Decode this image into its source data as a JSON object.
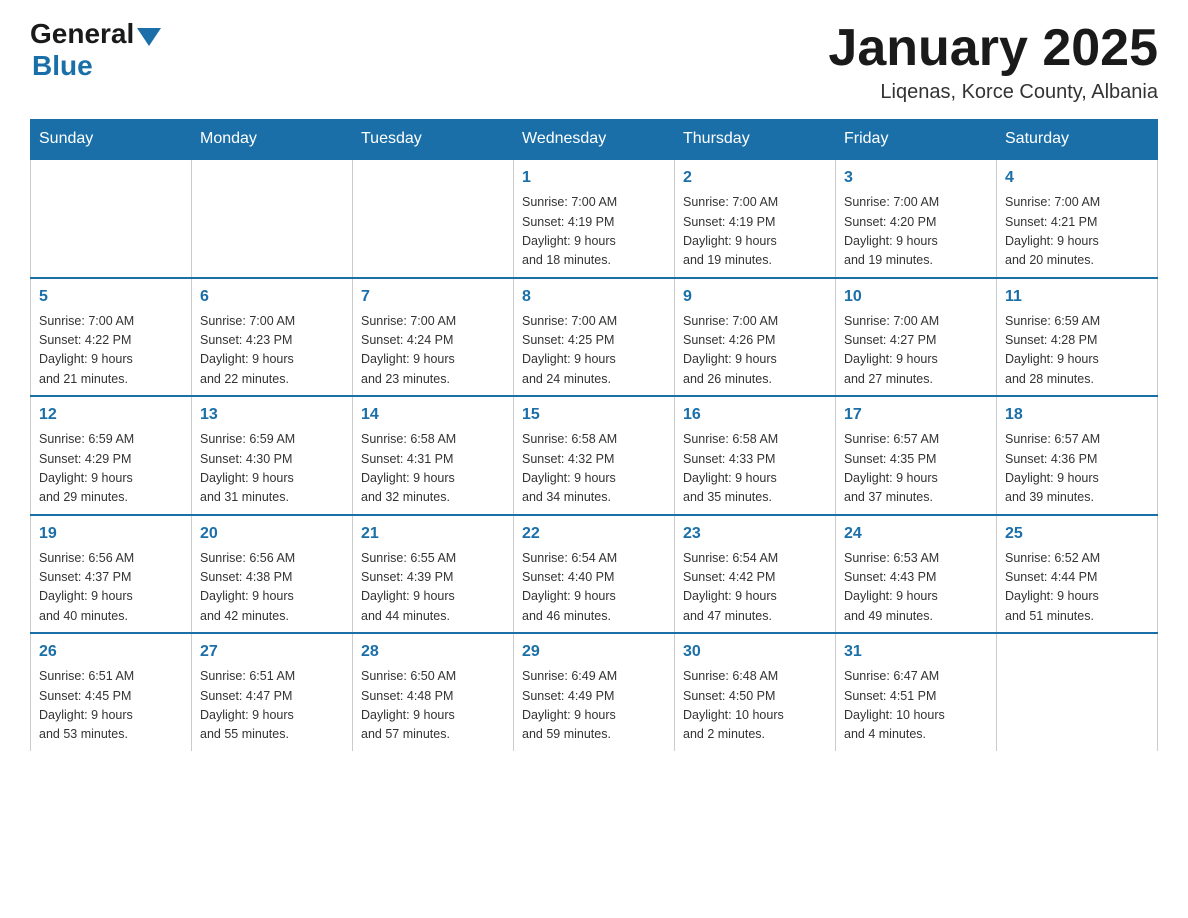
{
  "header": {
    "logo_general": "General",
    "logo_blue": "Blue",
    "title": "January 2025",
    "location": "Liqenas, Korce County, Albania"
  },
  "days_of_week": [
    "Sunday",
    "Monday",
    "Tuesday",
    "Wednesday",
    "Thursday",
    "Friday",
    "Saturday"
  ],
  "weeks": [
    [
      {
        "day": "",
        "info": ""
      },
      {
        "day": "",
        "info": ""
      },
      {
        "day": "",
        "info": ""
      },
      {
        "day": "1",
        "info": "Sunrise: 7:00 AM\nSunset: 4:19 PM\nDaylight: 9 hours\nand 18 minutes."
      },
      {
        "day": "2",
        "info": "Sunrise: 7:00 AM\nSunset: 4:19 PM\nDaylight: 9 hours\nand 19 minutes."
      },
      {
        "day": "3",
        "info": "Sunrise: 7:00 AM\nSunset: 4:20 PM\nDaylight: 9 hours\nand 19 minutes."
      },
      {
        "day": "4",
        "info": "Sunrise: 7:00 AM\nSunset: 4:21 PM\nDaylight: 9 hours\nand 20 minutes."
      }
    ],
    [
      {
        "day": "5",
        "info": "Sunrise: 7:00 AM\nSunset: 4:22 PM\nDaylight: 9 hours\nand 21 minutes."
      },
      {
        "day": "6",
        "info": "Sunrise: 7:00 AM\nSunset: 4:23 PM\nDaylight: 9 hours\nand 22 minutes."
      },
      {
        "day": "7",
        "info": "Sunrise: 7:00 AM\nSunset: 4:24 PM\nDaylight: 9 hours\nand 23 minutes."
      },
      {
        "day": "8",
        "info": "Sunrise: 7:00 AM\nSunset: 4:25 PM\nDaylight: 9 hours\nand 24 minutes."
      },
      {
        "day": "9",
        "info": "Sunrise: 7:00 AM\nSunset: 4:26 PM\nDaylight: 9 hours\nand 26 minutes."
      },
      {
        "day": "10",
        "info": "Sunrise: 7:00 AM\nSunset: 4:27 PM\nDaylight: 9 hours\nand 27 minutes."
      },
      {
        "day": "11",
        "info": "Sunrise: 6:59 AM\nSunset: 4:28 PM\nDaylight: 9 hours\nand 28 minutes."
      }
    ],
    [
      {
        "day": "12",
        "info": "Sunrise: 6:59 AM\nSunset: 4:29 PM\nDaylight: 9 hours\nand 29 minutes."
      },
      {
        "day": "13",
        "info": "Sunrise: 6:59 AM\nSunset: 4:30 PM\nDaylight: 9 hours\nand 31 minutes."
      },
      {
        "day": "14",
        "info": "Sunrise: 6:58 AM\nSunset: 4:31 PM\nDaylight: 9 hours\nand 32 minutes."
      },
      {
        "day": "15",
        "info": "Sunrise: 6:58 AM\nSunset: 4:32 PM\nDaylight: 9 hours\nand 34 minutes."
      },
      {
        "day": "16",
        "info": "Sunrise: 6:58 AM\nSunset: 4:33 PM\nDaylight: 9 hours\nand 35 minutes."
      },
      {
        "day": "17",
        "info": "Sunrise: 6:57 AM\nSunset: 4:35 PM\nDaylight: 9 hours\nand 37 minutes."
      },
      {
        "day": "18",
        "info": "Sunrise: 6:57 AM\nSunset: 4:36 PM\nDaylight: 9 hours\nand 39 minutes."
      }
    ],
    [
      {
        "day": "19",
        "info": "Sunrise: 6:56 AM\nSunset: 4:37 PM\nDaylight: 9 hours\nand 40 minutes."
      },
      {
        "day": "20",
        "info": "Sunrise: 6:56 AM\nSunset: 4:38 PM\nDaylight: 9 hours\nand 42 minutes."
      },
      {
        "day": "21",
        "info": "Sunrise: 6:55 AM\nSunset: 4:39 PM\nDaylight: 9 hours\nand 44 minutes."
      },
      {
        "day": "22",
        "info": "Sunrise: 6:54 AM\nSunset: 4:40 PM\nDaylight: 9 hours\nand 46 minutes."
      },
      {
        "day": "23",
        "info": "Sunrise: 6:54 AM\nSunset: 4:42 PM\nDaylight: 9 hours\nand 47 minutes."
      },
      {
        "day": "24",
        "info": "Sunrise: 6:53 AM\nSunset: 4:43 PM\nDaylight: 9 hours\nand 49 minutes."
      },
      {
        "day": "25",
        "info": "Sunrise: 6:52 AM\nSunset: 4:44 PM\nDaylight: 9 hours\nand 51 minutes."
      }
    ],
    [
      {
        "day": "26",
        "info": "Sunrise: 6:51 AM\nSunset: 4:45 PM\nDaylight: 9 hours\nand 53 minutes."
      },
      {
        "day": "27",
        "info": "Sunrise: 6:51 AM\nSunset: 4:47 PM\nDaylight: 9 hours\nand 55 minutes."
      },
      {
        "day": "28",
        "info": "Sunrise: 6:50 AM\nSunset: 4:48 PM\nDaylight: 9 hours\nand 57 minutes."
      },
      {
        "day": "29",
        "info": "Sunrise: 6:49 AM\nSunset: 4:49 PM\nDaylight: 9 hours\nand 59 minutes."
      },
      {
        "day": "30",
        "info": "Sunrise: 6:48 AM\nSunset: 4:50 PM\nDaylight: 10 hours\nand 2 minutes."
      },
      {
        "day": "31",
        "info": "Sunrise: 6:47 AM\nSunset: 4:51 PM\nDaylight: 10 hours\nand 4 minutes."
      },
      {
        "day": "",
        "info": ""
      }
    ]
  ]
}
